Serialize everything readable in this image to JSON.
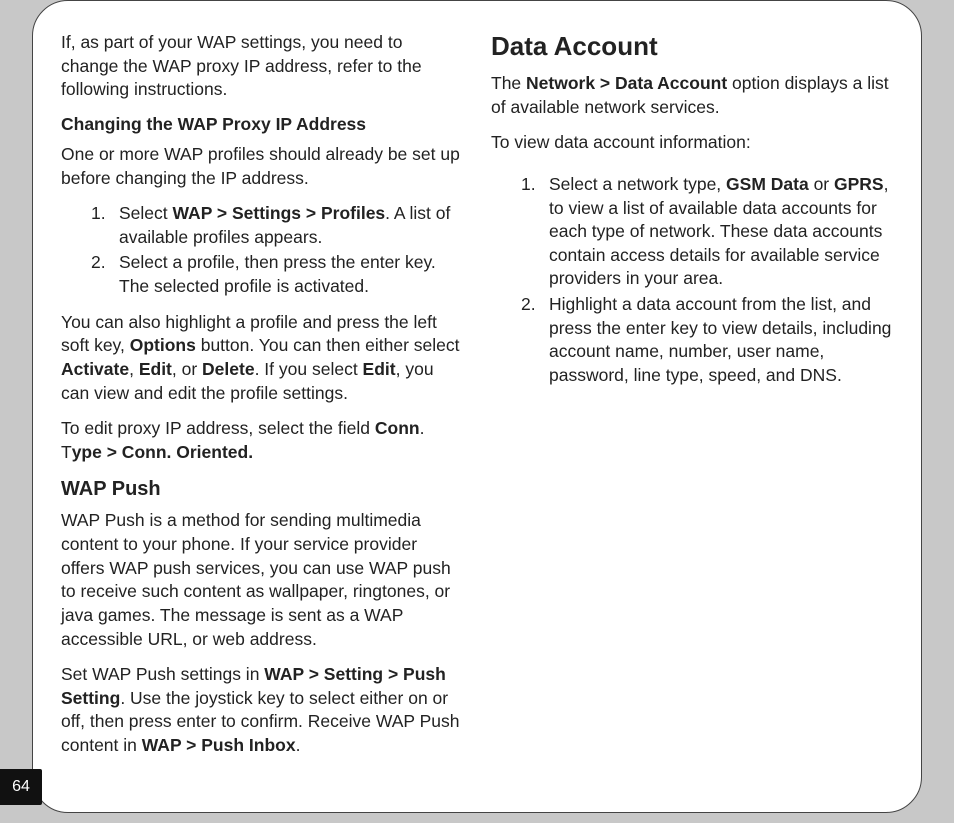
{
  "page_number": "64",
  "left": {
    "intro": "If, as part of your WAP settings, you need to change the WAP proxy IP address, refer to the following instructions.",
    "subhead": "Changing the WAP Proxy IP Address",
    "setup_note": "One or more WAP profiles should already be set up before changing the IP address.",
    "steps": {
      "s1a": "Select ",
      "s1b": "WAP > Settings > Profiles",
      "s1c": ". A list of available profiles appears.",
      "s2": "Select a profile, then press the enter key. The selected profile is activated."
    },
    "options_p1a": "You can also highlight a profile and press the left soft key, ",
    "options_p1b": "Options",
    "options_p1c": " button. You can then either select ",
    "options_p1d": "Activate",
    "options_p1e": ", ",
    "options_p1f": "Edit",
    "options_p1g": ", or ",
    "options_p1h": "Delete",
    "options_p1i": ". If you select ",
    "options_p1j": "Edit",
    "options_p1k": ", you can view and edit the profile settings.",
    "edit_p1a": "To edit proxy IP address, select the field ",
    "edit_p1b": "Conn",
    "edit_p1c": ". T",
    "edit_p1d": "ype > Conn. Oriented.",
    "wap_push_title": "WAP Push",
    "wap_push_body": "WAP Push is a method for sending multimedia content to your phone. If your service provider offers WAP push services, you can use WAP push to receive such content as wallpaper, ringtones, or java games. The message is sent as a WAP accessible URL, or web address.",
    "wap_push_set_a": "Set WAP Push settings in ",
    "wap_push_set_b": "WAP > Setting > Push Setting",
    "wap_push_set_c": ". Use the joystick key to select either on or off, then press enter to confirm. Receive WAP Push content in ",
    "wap_push_set_d": "WAP > Push Inbox",
    "wap_push_set_e": "."
  },
  "right": {
    "title": "Data Account",
    "intro_a": "The ",
    "intro_b": "Network > Data Account",
    "intro_c": " option displays a list of available network services.",
    "view_line": "To view data account information:",
    "steps": {
      "s1a": "Select a network type, ",
      "s1b": "GSM Data",
      "s1c": " or ",
      "s1d": "GPRS",
      "s1e": ", to view a list of available data accounts for each type of network. These data accounts contain access details for available service providers in your area.",
      "s2": "Highlight a data account from the list, and press the enter key to view details, including account name, number, user name, password, line type, speed, and DNS."
    }
  }
}
